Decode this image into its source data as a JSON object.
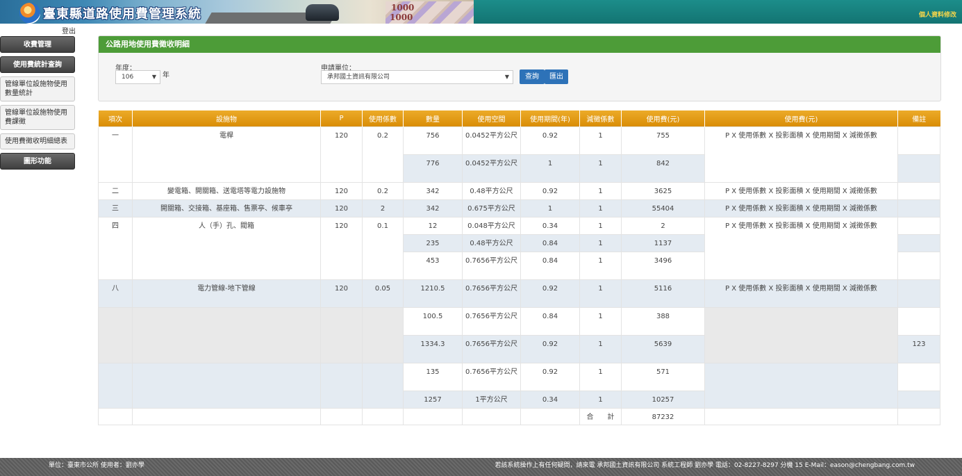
{
  "header": {
    "site_title": "臺東縣道路使用費管理系統",
    "profile_link": "個人資料修改",
    "logout": "登出",
    "banner_bill_text": [
      "1000",
      "1000"
    ]
  },
  "sidebar": {
    "items": [
      {
        "label": "收費管理",
        "style": "dark"
      },
      {
        "label": "使用費統計查詢",
        "style": "dark"
      },
      {
        "label": "管線單位設施物使用數量統計",
        "style": "light"
      },
      {
        "label": "管線單位設施物使用費課徵",
        "style": "light"
      },
      {
        "label": "使用費徵收明細總表",
        "style": "light"
      },
      {
        "label": "圖形功能",
        "style": "dark"
      }
    ]
  },
  "panel": {
    "title": "公路用地使用費徵收明細",
    "year_label": "年度：",
    "year_value": "106",
    "year_suffix": "年",
    "unit_label": "申請單位：",
    "unit_value": "承邦國土資訊有限公司",
    "query_button": "查詢",
    "export_button": "匯出"
  },
  "table": {
    "headers": [
      "項次",
      "設施物",
      "P",
      "使用係數",
      "數量",
      "使用空間",
      "使用期間(年)",
      "減徵係數",
      "使用費(元)",
      "使用費(元)",
      "備註"
    ],
    "formula": "P X 使用係數 X 投影面積 X 使用期間 X 減徵係數",
    "groups": [
      {
        "no": "一",
        "facility": "電桿",
        "p": "120",
        "coef": "0.2",
        "show_formula": true,
        "rows": [
          {
            "qty": "756",
            "space": "0.0452平方公尺",
            "period": "0.92",
            "reduce": "1",
            "fee": "755",
            "note": ""
          },
          {
            "qty": "776",
            "space": "0.0452平方公尺",
            "period": "1",
            "reduce": "1",
            "fee": "842",
            "note": ""
          }
        ]
      },
      {
        "no": "二",
        "facility": "變電箱、開關箱、送電塔等電力設施物",
        "p": "120",
        "coef": "0.2",
        "show_formula": true,
        "rows": [
          {
            "qty": "342",
            "space": "0.48平方公尺",
            "period": "0.92",
            "reduce": "1",
            "fee": "3625",
            "note": ""
          }
        ]
      },
      {
        "no": "三",
        "facility": "開關箱、交接箱、基座箱、售票亭、候車亭",
        "p": "120",
        "coef": "2",
        "show_formula": true,
        "rows": [
          {
            "qty": "342",
            "space": "0.675平方公尺",
            "period": "1",
            "reduce": "1",
            "fee": "55404",
            "note": ""
          }
        ]
      },
      {
        "no": "四",
        "facility": "人（手）孔、閥箱",
        "p": "120",
        "coef": "0.1",
        "show_formula": true,
        "rows": [
          {
            "qty": "12",
            "space": "0.048平方公尺",
            "period": "0.34",
            "reduce": "1",
            "fee": "2",
            "note": ""
          },
          {
            "qty": "235",
            "space": "0.48平方公尺",
            "period": "0.84",
            "reduce": "1",
            "fee": "1137",
            "note": ""
          },
          {
            "qty": "453",
            "space": "0.7656平方公尺",
            "period": "0.84",
            "reduce": "1",
            "fee": "3496",
            "note": ""
          }
        ]
      },
      {
        "no": "八",
        "facility": "電力管線-地下管線",
        "p": "120",
        "coef": "0.05",
        "show_formula": true,
        "rows": [
          {
            "qty": "1210.5",
            "space": "0.7656平方公尺",
            "period": "0.92",
            "reduce": "1",
            "fee": "5116",
            "note": ""
          },
          {
            "qty": "100.5",
            "space": "0.7656平方公尺",
            "period": "0.84",
            "reduce": "1",
            "fee": "388",
            "note": ""
          },
          {
            "qty": "1334.3",
            "space": "0.7656平方公尺",
            "period": "0.92",
            "reduce": "1",
            "fee": "5639",
            "note": "123"
          },
          {
            "qty": "135",
            "space": "0.7656平方公尺",
            "period": "0.92",
            "reduce": "1",
            "fee": "571",
            "note": ""
          },
          {
            "qty": "1257",
            "space": "1平方公尺",
            "period": "0.34",
            "reduce": "1",
            "fee": "10257",
            "note": ""
          }
        ]
      }
    ],
    "total_label": "合　　計",
    "total_value": "87232"
  },
  "footer": {
    "left": "單位：臺東市公所 使用者：劉亦學",
    "right": "若該系統操作上有任何疑問，請來電 承邦國土資訊有限公司 系統工程師 劉亦學 電話：02-8227-8297 分機 15 E-Mail：eason@chengbang.com.tw"
  }
}
